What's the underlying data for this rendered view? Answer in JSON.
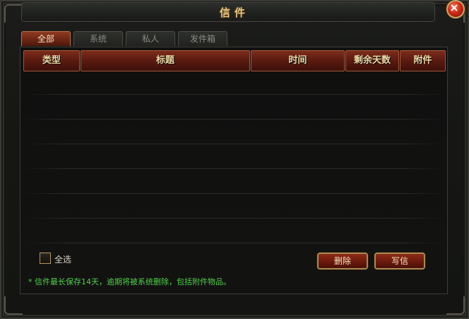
{
  "window": {
    "title": "信件"
  },
  "tabs": [
    {
      "label": "全部",
      "active": true
    },
    {
      "label": "系统",
      "active": false
    },
    {
      "label": "私人",
      "active": false
    },
    {
      "label": "发件箱",
      "active": false
    }
  ],
  "table": {
    "columns": [
      "类型",
      "标题",
      "时间",
      "剩余天数",
      "附件"
    ],
    "rows": []
  },
  "select_all": {
    "label": "全选",
    "checked": false
  },
  "buttons": {
    "delete_label": "删除",
    "write_label": "写信"
  },
  "note": "* 信件最长保存14天，逾期将被系统删除，包括附件物品。",
  "colors": {
    "accent": "#e8c983",
    "header_red": "#7c2c1c",
    "note_green": "#4fd04a"
  }
}
